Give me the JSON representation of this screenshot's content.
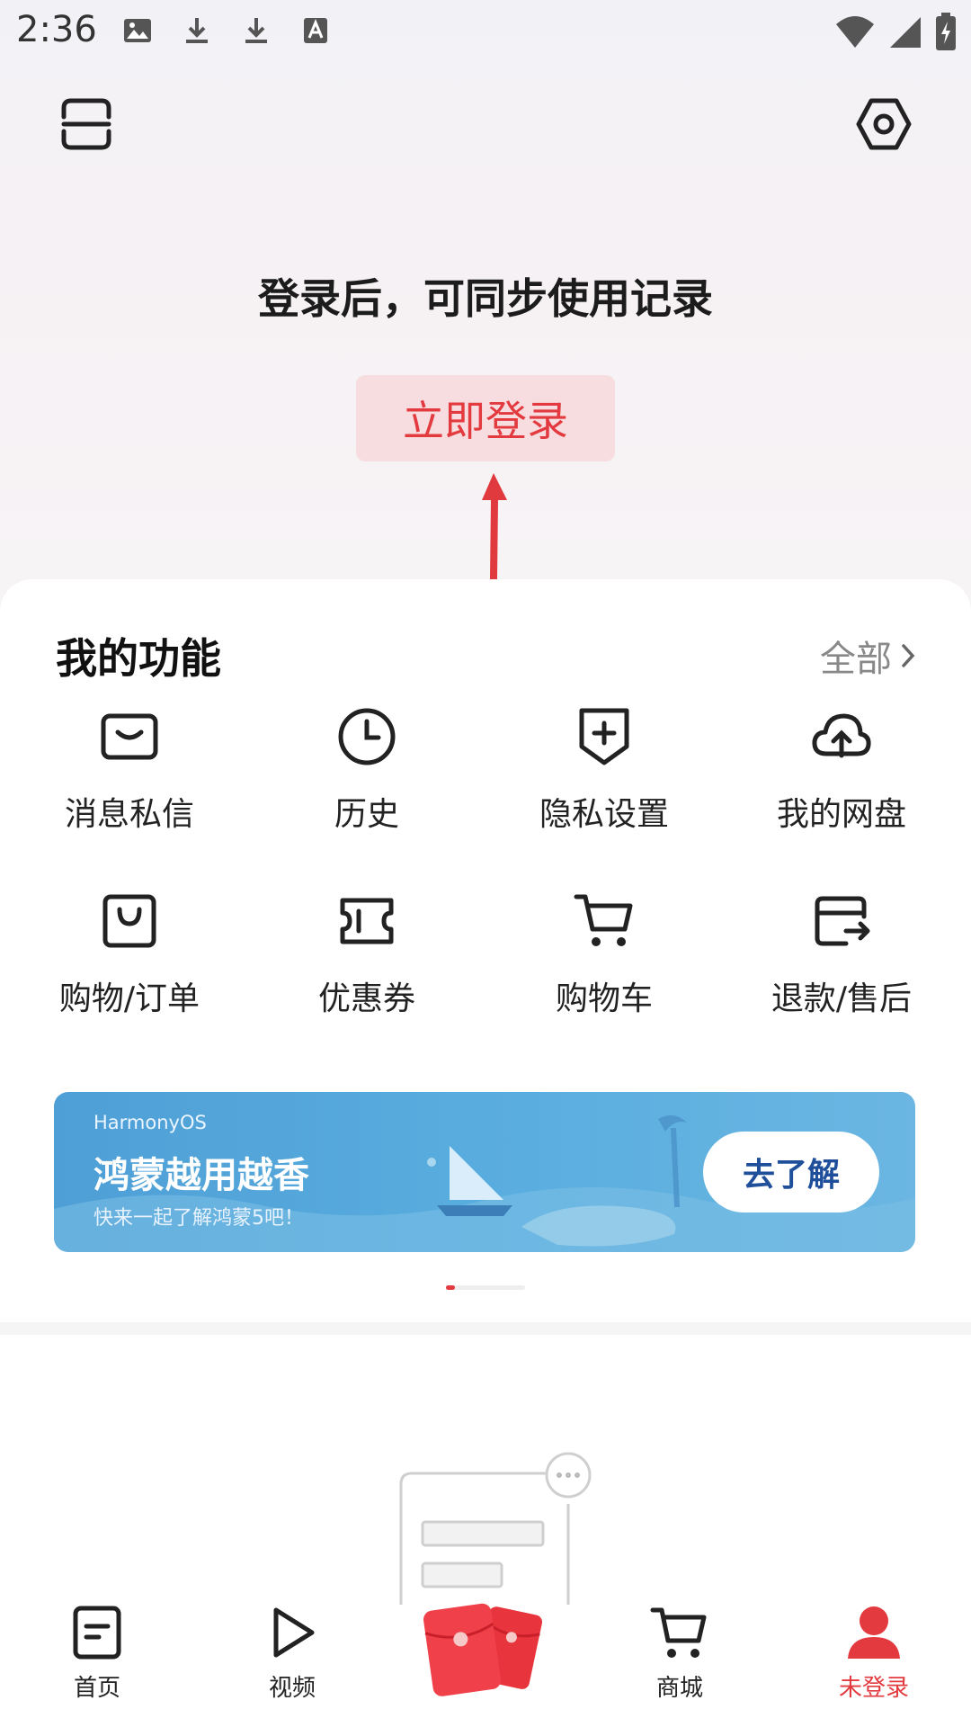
{
  "status_bar": {
    "time": "2:36",
    "left_icons": [
      "image-icon",
      "download-icon",
      "download-icon",
      "font-a-icon"
    ],
    "right_icons": [
      "wifi-icon",
      "signal-icon",
      "battery-charging-icon"
    ]
  },
  "header": {
    "scan_icon": "scan-icon",
    "settings_icon": "settings-hex-icon"
  },
  "login": {
    "hint": "登录后，可同步使用记录",
    "button_label": "立即登录"
  },
  "features": {
    "title": "我的功能",
    "all_label": "全部",
    "items": [
      {
        "label": "消息私信",
        "icon": "mail-icon"
      },
      {
        "label": "历史",
        "icon": "clock-icon"
      },
      {
        "label": "隐私设置",
        "icon": "shield-plus-icon"
      },
      {
        "label": "我的网盘",
        "icon": "cloud-upload-icon"
      },
      {
        "label": "购物/订单",
        "icon": "shopping-bag-icon"
      },
      {
        "label": "优惠券",
        "icon": "coupon-icon"
      },
      {
        "label": "购物车",
        "icon": "cart-icon"
      },
      {
        "label": "退款/售后",
        "icon": "refund-card-icon"
      }
    ]
  },
  "banner": {
    "brand": "HarmonyOS",
    "title": "鸿蒙越用越香",
    "subtitle": "快来一起了解鸿蒙5吧！",
    "cta": "去了解",
    "pager_index": 1,
    "pager_total": 8
  },
  "bottom_nav": {
    "items": [
      {
        "label": "首页",
        "icon": "home-doc-icon",
        "active": false
      },
      {
        "label": "视频",
        "icon": "play-icon",
        "active": false
      },
      {
        "label": "",
        "icon": "red-packet-icon",
        "active": false
      },
      {
        "label": "商城",
        "icon": "cart-icon",
        "active": false
      },
      {
        "label": "未登录",
        "icon": "user-icon",
        "active": true
      }
    ]
  },
  "colors": {
    "accent_red": "#e23a3f",
    "login_button_bg": "#f7dde0",
    "banner_blue": "#5aaedf",
    "cta_text": "#1f4f9a"
  }
}
